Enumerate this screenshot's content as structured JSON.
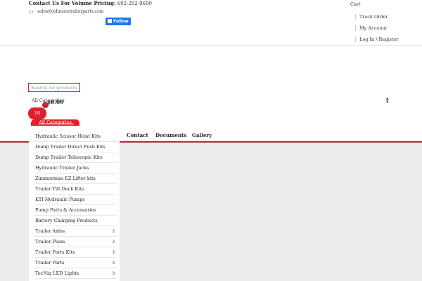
{
  "topbar": {
    "contact_label": "Contact Us For Volume Pricing:",
    "phone": "602-292-9690",
    "email": "sales@johnsontrailerparts.com",
    "follow_label": "Follow",
    "links": [
      "Cart",
      "Track Order",
      "My Account",
      "Log In / Register"
    ]
  },
  "search": {
    "placeholder": "Search for products...",
    "category_select": "All Categories",
    "button_label": "10",
    "cart_total": "$0.00"
  },
  "all_categories_tab": "All Categories",
  "nav": {
    "items": [
      "Contact",
      "Documents",
      "Gallery"
    ]
  },
  "categories": [
    {
      "label": "Hydraulic Scissor Hoist Kits",
      "has_sub": false
    },
    {
      "label": "Dump Trailer Direct Push Kits",
      "has_sub": false
    },
    {
      "label": "Dump Trailer Telescopic Kits",
      "has_sub": false
    },
    {
      "label": "Hydraulic Trailer Jacks",
      "has_sub": false
    },
    {
      "label": "Zimmerman EZ Lifter kits",
      "has_sub": false
    },
    {
      "label": "Trailer Tilt Deck Kits",
      "has_sub": false
    },
    {
      "label": "KTI Hydraulic Pumps",
      "has_sub": false
    },
    {
      "label": "Pump Parts & Accessories",
      "has_sub": false
    },
    {
      "label": "Battery Charging Products",
      "has_sub": false
    },
    {
      "label": "Trailer Axles",
      "has_sub": true
    },
    {
      "label": "Trailer Plans",
      "has_sub": true
    },
    {
      "label": "Trailer Parts Kits",
      "has_sub": true
    },
    {
      "label": "Trailer Parts",
      "has_sub": true
    },
    {
      "label": "TecNiq LED Lights",
      "has_sub": true
    }
  ],
  "sub_arrow_glyph": "b",
  "colors": {
    "accent": "#e41e2b",
    "border_red": "#c0272d",
    "facebook": "#1877f2",
    "body_gray": "#ebebeb"
  }
}
